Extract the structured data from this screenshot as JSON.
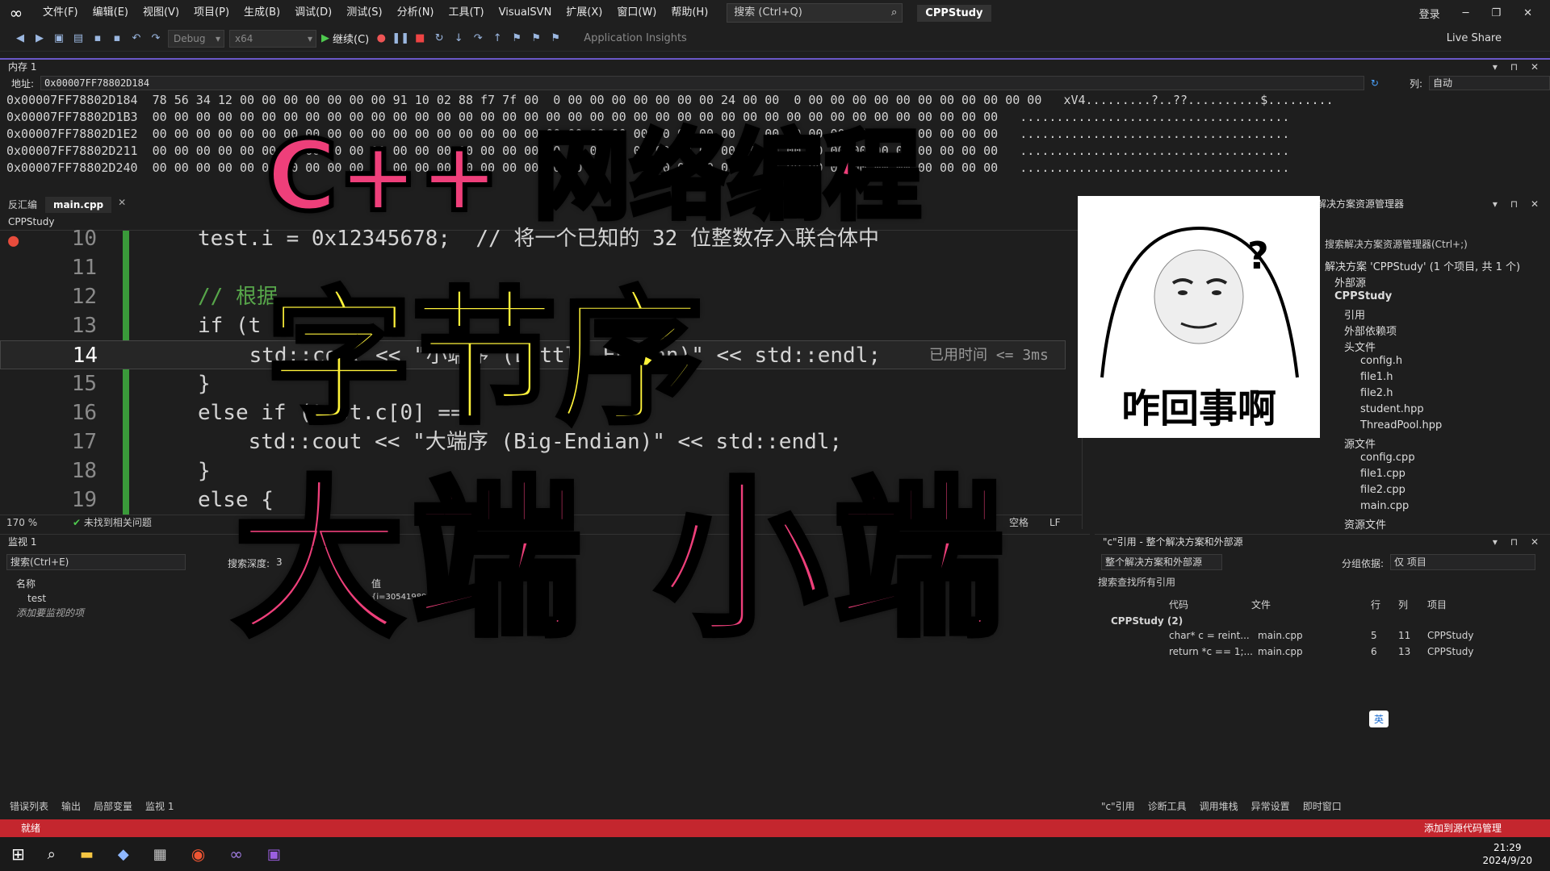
{
  "menubar": {
    "items": [
      "文件(F)",
      "编辑(E)",
      "视图(V)",
      "项目(P)",
      "生成(B)",
      "调试(D)",
      "测试(S)",
      "分析(N)",
      "工具(T)",
      "VisualSVN",
      "扩展(X)",
      "窗口(W)",
      "帮助(H)"
    ],
    "search_placeholder": "搜索 (Ctrl+Q)",
    "solution_name": "CPPStudy",
    "login": "登录"
  },
  "toolbar": {
    "config": "Debug",
    "platform": "x64",
    "continue_label": "继续(C)",
    "app_insights": "Application Insights",
    "live_share": "Live Share"
  },
  "memory": {
    "title": "内存 1",
    "address_label": "地址:",
    "address_value": "0x00007FF78802D184",
    "columns_label": "列:",
    "columns_value": "自动",
    "rows": [
      "0x00007FF78802D184  78 56 34 12 00 00 00 00 00 00 00 91 10 02 88 f7 7f 00  0 00 00 00 00 00 00 00 24 00 00  0 00 00 00 00 00 00 00 00 00 00 00   xV4.........?..??..........$.........",
      "0x00007FF78802D1B3  00 00 00 00 00 00 00 00 00 00 00 00 00 00 00 00 00 00 00 00 00 00 00 00 00 00 00 00 00 00 00 00 00 00 00 00 00 00 00   .....................................",
      "0x00007FF78802D1E2  00 00 00 00 00 00 00 00 00 00 00 00 00 00 00 00 00 00 00 00 00 00 00 00 00 00 00 00 00 00 00 00 00 00 00 00 00 00 00   .....................................",
      "0x00007FF78802D211  00 00 00 00 00 00 00 00 00 00 00 00 00 00 00 00 00 00 00 00 00 00 00 00 00 00 00 00 00 00 00 00 00 00 00 00 00 00 00   .....................................",
      "0x00007FF78802D240  00 00 00 00 00 00 00 00 00 00 00 00 00 00 00 00 00 00 00 00 00 00 00 00 00 00 00 00 00 00 00 00 00 00 00 00 00 00 00   ....................................."
    ]
  },
  "editor": {
    "tabs": [
      "反汇编",
      "main.cpp"
    ],
    "nav_project": "CPPStudy",
    "lines": [
      {
        "n": "10",
        "text": "test.i = 0x12345678;  // 将一个已知的 32 位整数存入联合体中"
      },
      {
        "n": "11",
        "text": ""
      },
      {
        "n": "12",
        "text": "// 根据"
      },
      {
        "n": "13",
        "text": "if (t"
      },
      {
        "n": "14",
        "text": "    std::cout << \"小端序 (Little-Endian)\" << std::endl;",
        "hint": "已用时间 <= 3ms"
      },
      {
        "n": "15",
        "text": "}"
      },
      {
        "n": "16",
        "text": "else if (test.c[0] =="
      },
      {
        "n": "17",
        "text": "    std::cout << \"大端序 (Big-Endian)\" << std::endl;"
      },
      {
        "n": "18",
        "text": "}"
      },
      {
        "n": "19",
        "text": "else {"
      }
    ],
    "zoom": "170 %",
    "issues": "未找到相关问题",
    "row": "行: 14",
    "char": "字符: 1",
    "spacing": "空格",
    "eol": "LF"
  },
  "solution_explorer": {
    "title": "解决方案资源管理器",
    "search": "搜索解决方案资源管理器(Ctrl+;)",
    "items": [
      "解决方案 'CPPStudy' (1 个项目, 共 1 个)",
      "外部源",
      "CPPStudy",
      "引用",
      "外部依赖项",
      "头文件",
      "config.h",
      "file1.h",
      "file2.h",
      "student.hpp",
      "ThreadPool.hpp",
      "源文件",
      "config.cpp",
      "file1.cpp",
      "file2.cpp",
      "main.cpp",
      "资源文件"
    ]
  },
  "watch": {
    "title": "监视 1",
    "search": "搜索(Ctrl+E)",
    "search_depth": "搜索深度:",
    "depth_val": "3",
    "col_name": "名称",
    "col_value": "值",
    "row_name": "test",
    "row_value": "{i=305419896 ...}",
    "add_hint": "添加要监视的项",
    "bottom_tabs": [
      "错误列表",
      "输出",
      "局部变量",
      "监视 1"
    ]
  },
  "references": {
    "title": "\"c\"引用 - 整个解决方案和外部源",
    "scope": "整个解决方案和外部源",
    "group_label": "分组依据:",
    "group_value": "仅 项目",
    "search": "搜索查找所有引用",
    "cols": [
      "代码",
      "文件",
      "行",
      "列",
      "项目"
    ],
    "group": "CPPStudy (2)",
    "rows": [
      [
        "char* c = reint...",
        "main.cpp",
        "5",
        "11",
        "CPPStudy"
      ],
      [
        "return *c == 1;...",
        "main.cpp",
        "6",
        "13",
        "CPPStudy"
      ]
    ],
    "bottom_tabs": [
      "\"c\"引用",
      "诊断工具",
      "调用堆栈",
      "异常设置",
      "即时窗口"
    ]
  },
  "statusbar": {
    "ready": "就绪",
    "source_control": "添加到源代码管理"
  },
  "taskbar": {
    "time": "21:29",
    "date": "2024/9/20"
  },
  "overlay": {
    "title1": "C++ 网络编程",
    "title2": "字节序",
    "title3": "大端 小端",
    "meme_caption": "咋回事啊"
  },
  "ime": {
    "mode": "英"
  }
}
